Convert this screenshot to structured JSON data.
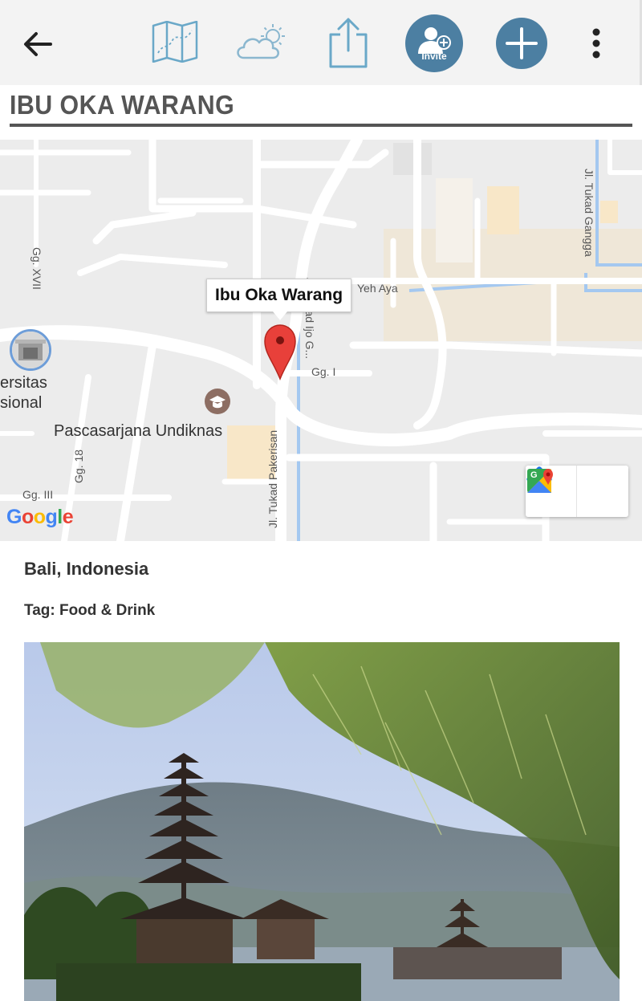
{
  "toolbar": {
    "back_icon": "arrow-left-icon",
    "map_icon": "folded-map-icon",
    "weather_icon": "partly-cloudy-icon",
    "share_icon": "share-icon",
    "invite_label": "Invite",
    "add_icon": "plus-icon",
    "more_icon": "vertical-dots-icon",
    "accent_color": "#4c7fa2"
  },
  "place": {
    "title": "IBU OKA WARANG",
    "location": "Bali, Indonesia",
    "tag": "Tag: Food & Drink"
  },
  "map": {
    "marker_label": "Ibu Oka Warang",
    "labels": {
      "yeh_aya": "Yeh Aya",
      "gg_xvii": "Gg. XVII",
      "jl_tukad_gangga": "Jl. Tukad Gangga",
      "jl_tukad_ijo": "Jl. Tukad Ijo G...",
      "gg_i": "Gg. I",
      "ersitas": "ersitas",
      "sional": "sional",
      "pascasarjana": "Pascasarjana Undiknas",
      "gg_18": "Gg. 18",
      "gg_iii": "Gg. III",
      "jl_tukad_pakerisan": "Jl. Tukad Pakerisan"
    },
    "attribution": "Google",
    "directions_icon": "directions-icon",
    "google_maps_icon": "google-maps-icon"
  },
  "photo": {
    "subject": "Pura Ulun Danu Bratan temple by a lake"
  }
}
